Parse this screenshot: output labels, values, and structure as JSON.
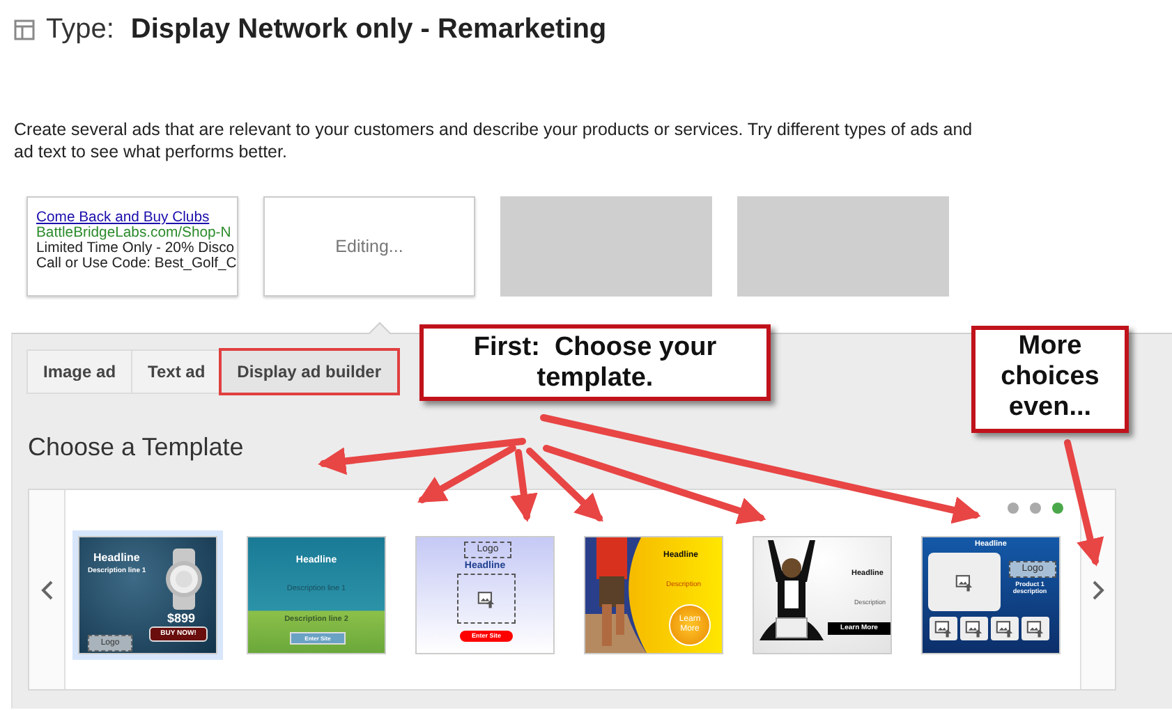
{
  "header": {
    "label": "Type:",
    "value": "Display Network only - Remarketing"
  },
  "description": "Create several ads that are relevant to your customers and describe your products or services. Try different types of ads and ad text to see what performs better.",
  "ad_previews": [
    {
      "kind": "text",
      "headline": "Come Back and Buy Clubs",
      "url": "BattleBridgeLabs.com/Shop-N",
      "lines": [
        "Limited Time Only - 20% Disco",
        "Call or Use Code: Best_Golf_C"
      ]
    },
    {
      "kind": "status",
      "label": "Editing..."
    },
    {
      "kind": "empty"
    },
    {
      "kind": "empty"
    }
  ],
  "tabs": [
    {
      "label": "Image ad",
      "selected": false,
      "highlighted": false
    },
    {
      "label": "Text ad",
      "selected": false,
      "highlighted": false
    },
    {
      "label": "Display ad builder",
      "selected": true,
      "highlighted": true
    }
  ],
  "section_title": "Choose a Template",
  "carousel": {
    "pages": [
      {
        "selected": false
      },
      {
        "selected": false
      },
      {
        "selected": true
      }
    ],
    "templates": [
      {
        "kind": "watch",
        "selected": true,
        "texts": [
          "Headline",
          "Description line 1",
          "$899",
          "BUY NOW!",
          "Logo"
        ]
      },
      {
        "kind": "banner",
        "selected": false,
        "texts": [
          "Headline",
          "Description line 1",
          "Description line 2",
          "Enter Site"
        ]
      },
      {
        "kind": "upload",
        "selected": false,
        "texts": [
          "Logo",
          "Headline",
          "Enter Site"
        ]
      },
      {
        "kind": "runner",
        "selected": false,
        "texts": [
          "Headline",
          "Description",
          "Learn More"
        ]
      },
      {
        "kind": "laptop",
        "selected": false,
        "texts": [
          "Headline",
          "Description",
          "Learn More"
        ]
      },
      {
        "kind": "gallery",
        "selected": false,
        "texts": [
          "Headline",
          "Logo",
          "Product 1 description"
        ]
      }
    ]
  },
  "annotations": [
    {
      "text": "First:  Choose your template."
    },
    {
      "text": "More choices even..."
    }
  ]
}
